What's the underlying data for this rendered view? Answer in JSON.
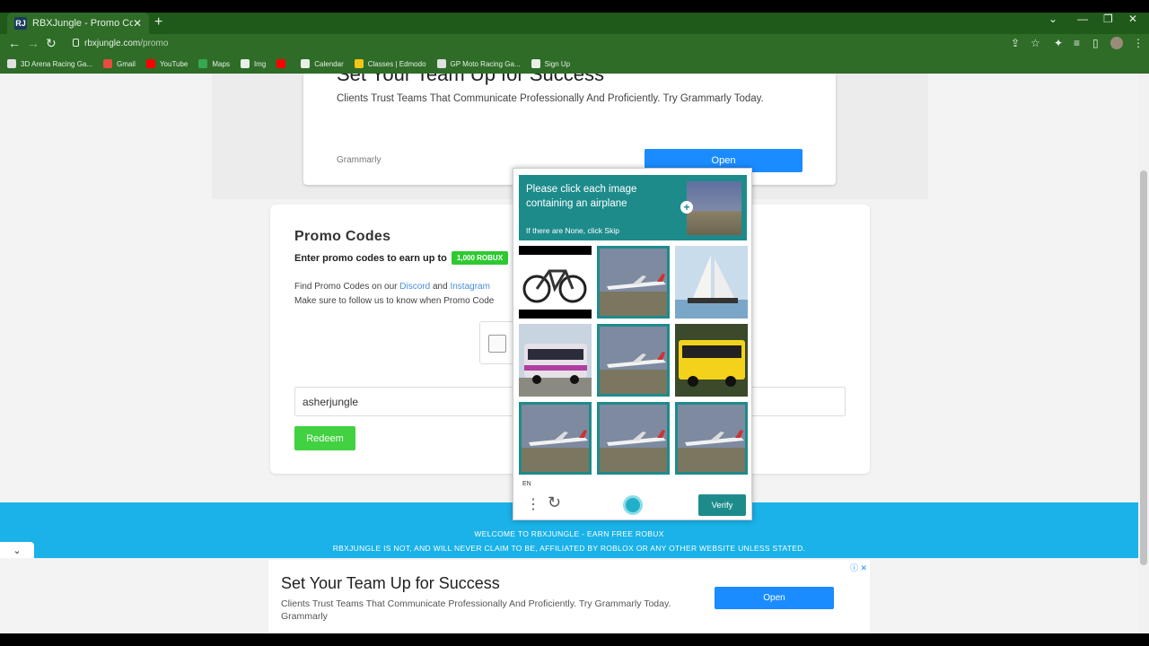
{
  "browser": {
    "tab_title": "RBXJungle - Promo Codes",
    "tab_favicon": "RJ",
    "tab_close": "✕",
    "new_tab": "+",
    "url_host": "rbxjungle.com",
    "url_path": "/promo",
    "bookmarks": [
      {
        "label": "3D Arena Racing Ga...",
        "icon": "game-icon",
        "color": "#e0e0e0"
      },
      {
        "label": "Gmail",
        "icon": "gmail-icon",
        "color": "#e74c3c"
      },
      {
        "label": "YouTube",
        "icon": "youtube-icon",
        "color": "#ff0000"
      },
      {
        "label": "Maps",
        "icon": "maps-icon",
        "color": "#34a853"
      },
      {
        "label": "Img",
        "icon": "globe-icon",
        "color": "#e8f0e6"
      },
      {
        "label": "",
        "icon": "youtube-icon",
        "color": "#ff0000"
      },
      {
        "label": "Calendar",
        "icon": "globe-icon",
        "color": "#e8f0e6"
      },
      {
        "label": "Classes | Edmodo",
        "icon": "edmodo-icon",
        "color": "#f5c518"
      },
      {
        "label": "GP Moto Racing Ga...",
        "icon": "game-icon",
        "color": "#e0e0e0"
      },
      {
        "label": "Sign Up",
        "icon": "globe-icon",
        "color": "#e8f0e6"
      }
    ]
  },
  "top_ad": {
    "headline": "Set Your Team Up for Success",
    "description": "Clients Trust Teams That Communicate Professionally And Proficiently. Try Grammarly Today.",
    "brand": "Grammarly",
    "button": "Open"
  },
  "promo": {
    "title": "Promo Codes",
    "subtitle": "Enter promo codes to earn up to",
    "badge": "1,000 ROBUX",
    "find_prefix": "Find Promo Codes on our",
    "discord": "Discord",
    "and": "and",
    "instagram": "Instagram",
    "follow_text": "Make sure to follow us to know when Promo Code",
    "code_value": "asherjungle",
    "redeem": "Redeem"
  },
  "captcha": {
    "prompt": "Please click each image containing an airplane",
    "skip_hint": "If there are None, click Skip",
    "lang": "EN",
    "verify": "Verify",
    "tiles": [
      {
        "subject": "bicycle",
        "selected": false
      },
      {
        "subject": "airplane",
        "selected": true
      },
      {
        "subject": "sailboat",
        "selected": false
      },
      {
        "subject": "bus",
        "selected": false
      },
      {
        "subject": "airplane",
        "selected": true
      },
      {
        "subject": "bus",
        "selected": false
      },
      {
        "subject": "airplane",
        "selected": true
      },
      {
        "subject": "airplane",
        "selected": true
      },
      {
        "subject": "airplane",
        "selected": true
      }
    ]
  },
  "footer": {
    "line1": "WELCOME TO RBXJUNGLE - EARN FREE ROBUX",
    "line2": "RBXJUNGLE IS NOT, AND WILL NEVER CLAIM TO BE, AFFILIATED BY ROBLOX OR ANY OTHER WEBSITE UNLESS STATED."
  },
  "bottom_ad": {
    "headline": "Set Your Team Up for Success",
    "description": "Clients Trust Teams That Communicate Professionally And Proficiently. Try Grammarly Today. Grammarly",
    "button": "Open"
  },
  "colors": {
    "browser_chrome": "#2e6c28",
    "captcha_teal": "#1e8b8b",
    "footer_blue": "#1ab2e8",
    "redeem_green": "#41d141",
    "ad_button_blue": "#1a8cff"
  }
}
